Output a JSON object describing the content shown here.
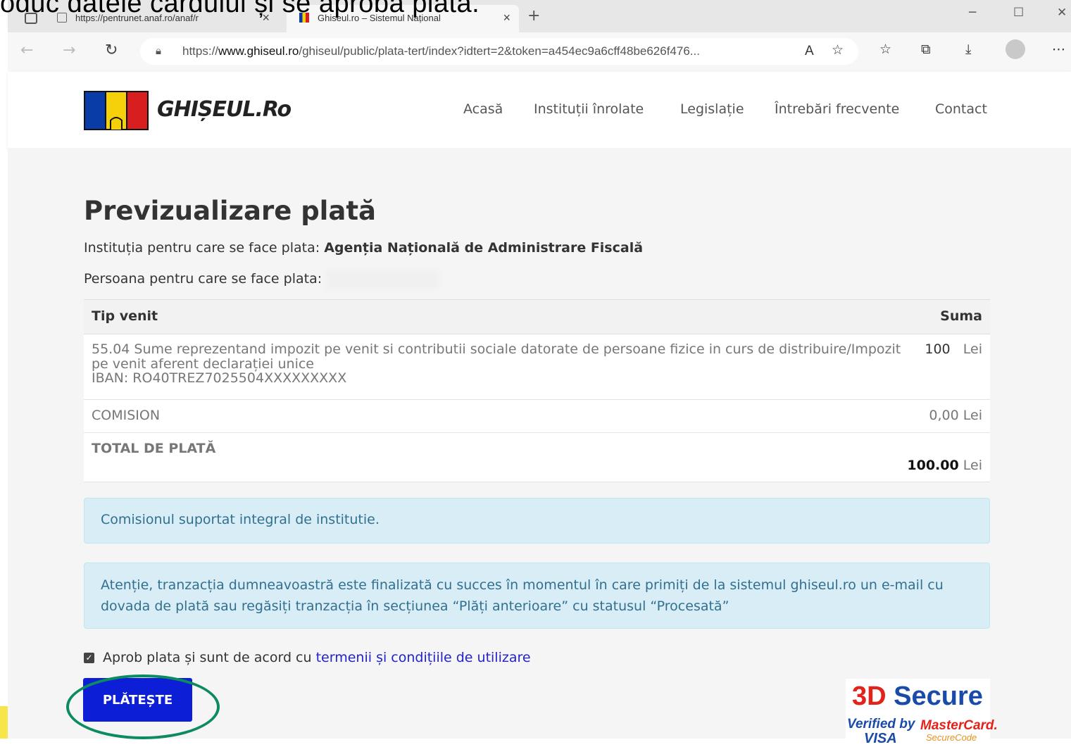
{
  "slide": {
    "caption": "oduc datele cardului și se aprobă plata."
  },
  "browser": {
    "tabs": [
      {
        "label": "https://pentrunet.anaf.ro/anaf/r"
      },
      {
        "label": "Ghiseul.ro – Sistemul Național"
      }
    ],
    "url_prefix": "https://",
    "url_domain": "www.ghiseul.ro",
    "url_path": "/ghiseul/public/plata-tert/index?idtert=2&token=a454ec9a6cff48be626f476..."
  },
  "site": {
    "logo_text": "GHIȘEUL.Ro",
    "nav": [
      "Acasă",
      "Instituții înrolate",
      "Legislație",
      "Întrebări frecvente",
      "Contact"
    ]
  },
  "page": {
    "title": "Previzualizare plată",
    "institution_label": "Instituția pentru care se face plata:",
    "institution_value": "Agenția Națională de Administrare Fiscală",
    "person_label": "Persoana pentru care se face plata:",
    "table": {
      "headers": [
        "Tip venit",
        "Suma"
      ],
      "row_desc_line1": "55.04 Sume reprezentand impozit pe venit si contributii sociale datorate de persoane fizice in curs de distribuire/Impozit",
      "row_desc_line2": "pe venit aferent declarației unice",
      "row_iban": "IBAN: RO40TREZ7025504XXXXXXXXX",
      "row_amount": "100",
      "row_currency": "Lei",
      "commission_label": "COMISION",
      "commission_value": "0,00 Lei",
      "total_label": "TOTAL DE PLATĂ",
      "total_value": "100.00",
      "total_currency": "Lei"
    },
    "info_commission": "Comisionul suportat integral de institutie.",
    "info_warning_line1": "Atenție, tranzacția dumneavoastră este finalizată cu succes în momentul în care primiți de la sistemul ghiseul.ro un e-mail cu",
    "info_warning_line2": "dovada de plată sau regăsiți tranzacția în secțiunea “Plăți anterioare” cu statusul “Procesată”",
    "agree_text": "Aprob plata și sunt de acord cu",
    "agree_link": "termenii și condițiile de utilizare",
    "pay_button": "PLĂTEȘTE",
    "badge": {
      "line1_a": "3D",
      "line1_b": "Secure",
      "verified": "Verified by",
      "visa": "VISA",
      "mastercard": "MasterCard.",
      "securecode": "SecureCode"
    }
  },
  "colors": {
    "primary_button": "#0d1fd6",
    "info_bg": "#d9edf7",
    "info_text": "#31708f",
    "link": "#2222cc",
    "highlight_ellipse": "#0c8a60"
  }
}
